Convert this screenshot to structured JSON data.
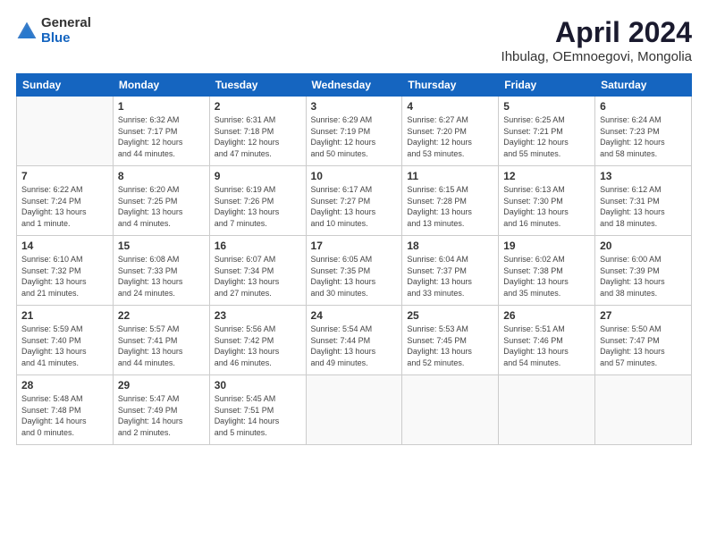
{
  "header": {
    "logo_general": "General",
    "logo_blue": "Blue",
    "title": "April 2024",
    "location": "Ihbulag, OEmnoegovi, Mongolia"
  },
  "weekdays": [
    "Sunday",
    "Monday",
    "Tuesday",
    "Wednesday",
    "Thursday",
    "Friday",
    "Saturday"
  ],
  "weeks": [
    [
      {
        "day": "",
        "info": ""
      },
      {
        "day": "1",
        "info": "Sunrise: 6:32 AM\nSunset: 7:17 PM\nDaylight: 12 hours\nand 44 minutes."
      },
      {
        "day": "2",
        "info": "Sunrise: 6:31 AM\nSunset: 7:18 PM\nDaylight: 12 hours\nand 47 minutes."
      },
      {
        "day": "3",
        "info": "Sunrise: 6:29 AM\nSunset: 7:19 PM\nDaylight: 12 hours\nand 50 minutes."
      },
      {
        "day": "4",
        "info": "Sunrise: 6:27 AM\nSunset: 7:20 PM\nDaylight: 12 hours\nand 53 minutes."
      },
      {
        "day": "5",
        "info": "Sunrise: 6:25 AM\nSunset: 7:21 PM\nDaylight: 12 hours\nand 55 minutes."
      },
      {
        "day": "6",
        "info": "Sunrise: 6:24 AM\nSunset: 7:23 PM\nDaylight: 12 hours\nand 58 minutes."
      }
    ],
    [
      {
        "day": "7",
        "info": "Sunrise: 6:22 AM\nSunset: 7:24 PM\nDaylight: 13 hours\nand 1 minute."
      },
      {
        "day": "8",
        "info": "Sunrise: 6:20 AM\nSunset: 7:25 PM\nDaylight: 13 hours\nand 4 minutes."
      },
      {
        "day": "9",
        "info": "Sunrise: 6:19 AM\nSunset: 7:26 PM\nDaylight: 13 hours\nand 7 minutes."
      },
      {
        "day": "10",
        "info": "Sunrise: 6:17 AM\nSunset: 7:27 PM\nDaylight: 13 hours\nand 10 minutes."
      },
      {
        "day": "11",
        "info": "Sunrise: 6:15 AM\nSunset: 7:28 PM\nDaylight: 13 hours\nand 13 minutes."
      },
      {
        "day": "12",
        "info": "Sunrise: 6:13 AM\nSunset: 7:30 PM\nDaylight: 13 hours\nand 16 minutes."
      },
      {
        "day": "13",
        "info": "Sunrise: 6:12 AM\nSunset: 7:31 PM\nDaylight: 13 hours\nand 18 minutes."
      }
    ],
    [
      {
        "day": "14",
        "info": "Sunrise: 6:10 AM\nSunset: 7:32 PM\nDaylight: 13 hours\nand 21 minutes."
      },
      {
        "day": "15",
        "info": "Sunrise: 6:08 AM\nSunset: 7:33 PM\nDaylight: 13 hours\nand 24 minutes."
      },
      {
        "day": "16",
        "info": "Sunrise: 6:07 AM\nSunset: 7:34 PM\nDaylight: 13 hours\nand 27 minutes."
      },
      {
        "day": "17",
        "info": "Sunrise: 6:05 AM\nSunset: 7:35 PM\nDaylight: 13 hours\nand 30 minutes."
      },
      {
        "day": "18",
        "info": "Sunrise: 6:04 AM\nSunset: 7:37 PM\nDaylight: 13 hours\nand 33 minutes."
      },
      {
        "day": "19",
        "info": "Sunrise: 6:02 AM\nSunset: 7:38 PM\nDaylight: 13 hours\nand 35 minutes."
      },
      {
        "day": "20",
        "info": "Sunrise: 6:00 AM\nSunset: 7:39 PM\nDaylight: 13 hours\nand 38 minutes."
      }
    ],
    [
      {
        "day": "21",
        "info": "Sunrise: 5:59 AM\nSunset: 7:40 PM\nDaylight: 13 hours\nand 41 minutes."
      },
      {
        "day": "22",
        "info": "Sunrise: 5:57 AM\nSunset: 7:41 PM\nDaylight: 13 hours\nand 44 minutes."
      },
      {
        "day": "23",
        "info": "Sunrise: 5:56 AM\nSunset: 7:42 PM\nDaylight: 13 hours\nand 46 minutes."
      },
      {
        "day": "24",
        "info": "Sunrise: 5:54 AM\nSunset: 7:44 PM\nDaylight: 13 hours\nand 49 minutes."
      },
      {
        "day": "25",
        "info": "Sunrise: 5:53 AM\nSunset: 7:45 PM\nDaylight: 13 hours\nand 52 minutes."
      },
      {
        "day": "26",
        "info": "Sunrise: 5:51 AM\nSunset: 7:46 PM\nDaylight: 13 hours\nand 54 minutes."
      },
      {
        "day": "27",
        "info": "Sunrise: 5:50 AM\nSunset: 7:47 PM\nDaylight: 13 hours\nand 57 minutes."
      }
    ],
    [
      {
        "day": "28",
        "info": "Sunrise: 5:48 AM\nSunset: 7:48 PM\nDaylight: 14 hours\nand 0 minutes."
      },
      {
        "day": "29",
        "info": "Sunrise: 5:47 AM\nSunset: 7:49 PM\nDaylight: 14 hours\nand 2 minutes."
      },
      {
        "day": "30",
        "info": "Sunrise: 5:45 AM\nSunset: 7:51 PM\nDaylight: 14 hours\nand 5 minutes."
      },
      {
        "day": "",
        "info": ""
      },
      {
        "day": "",
        "info": ""
      },
      {
        "day": "",
        "info": ""
      },
      {
        "day": "",
        "info": ""
      }
    ]
  ]
}
